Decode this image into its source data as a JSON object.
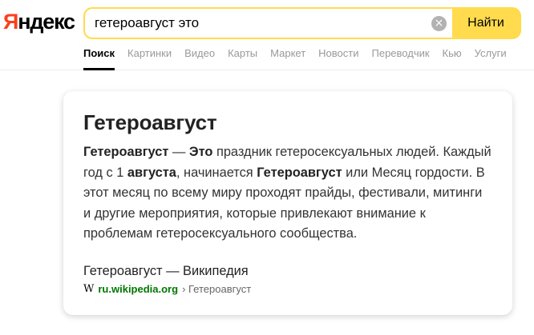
{
  "logo": {
    "first_letter": "Я",
    "rest": "ндекс"
  },
  "search": {
    "query": "гетероавгуст это",
    "clear_symbol": "×",
    "button_label": "Найти"
  },
  "tabs": [
    {
      "label": "Поиск",
      "active": true
    },
    {
      "label": "Картинки",
      "active": false
    },
    {
      "label": "Видео",
      "active": false
    },
    {
      "label": "Карты",
      "active": false
    },
    {
      "label": "Маркет",
      "active": false
    },
    {
      "label": "Новости",
      "active": false
    },
    {
      "label": "Переводчик",
      "active": false
    },
    {
      "label": "Кью",
      "active": false
    },
    {
      "label": "Услуги",
      "active": false
    }
  ],
  "card": {
    "title": "Гетероавгуст",
    "text": {
      "b1": "Гетероавгуст",
      "t1": " — ",
      "b2": "Это",
      "t2": " праздник гетеросексуальных людей. Каждый год с 1 ",
      "b3": "августа",
      "t3": ", начинается ",
      "b4": "Гетероавгуст",
      "t4": " или Месяц гордости. В этот месяц по всему миру проходят прайды, фестивали, митинги и другие мероприятия, которые привлекают внимание к проблемам гетеросексуального сообщества."
    },
    "source_title": "Гетероавгуст — Википедия",
    "source_icon": "wikipedia-icon",
    "source_icon_glyph": "W",
    "source_domain": "ru.wikipedia.org",
    "source_path": "› Гетероавгуст"
  },
  "colors": {
    "accent": "#ffdb4d",
    "logo_red": "#fc3f1d",
    "source_green": "#007700"
  }
}
